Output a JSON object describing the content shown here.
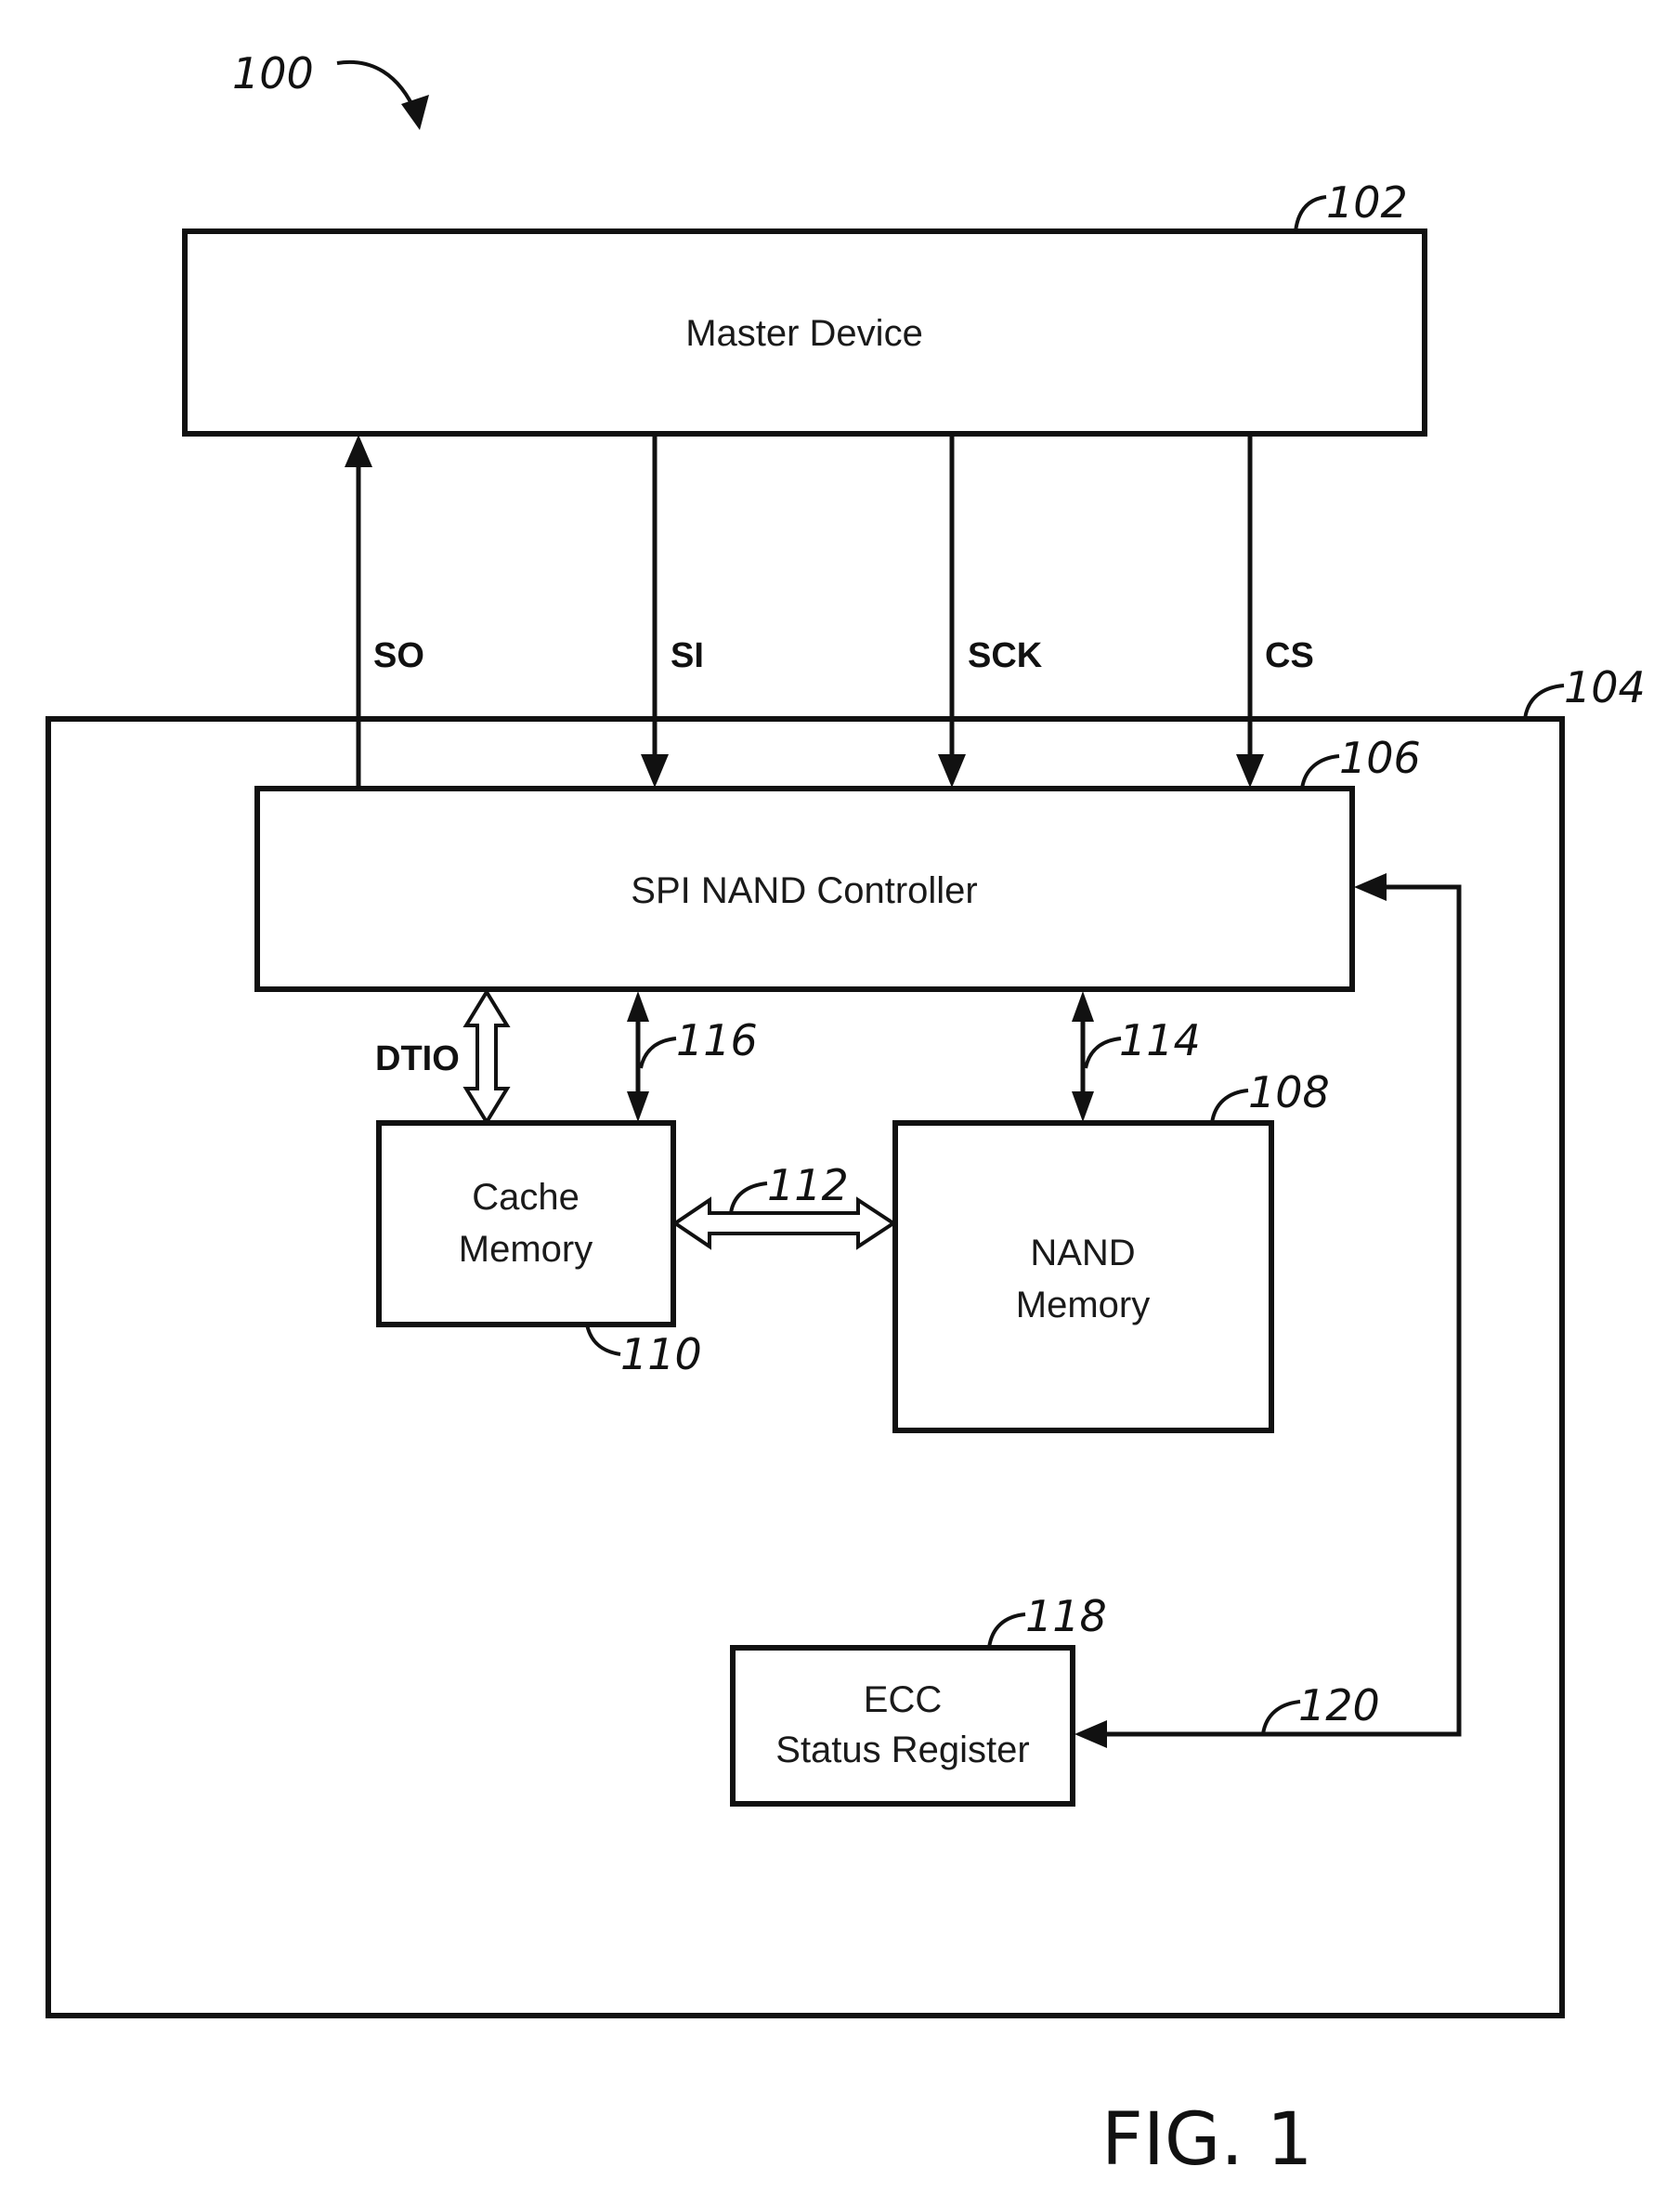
{
  "figure": {
    "ref": "100",
    "caption": "FIG. 1"
  },
  "blocks": {
    "master": {
      "label": "Master Device",
      "ref": "102"
    },
    "memory_device": {
      "ref": "104"
    },
    "controller": {
      "label": "SPI NAND Controller",
      "ref": "106"
    },
    "nand": {
      "label_lines": [
        "NAND",
        "Memory"
      ],
      "ref": "108"
    },
    "cache": {
      "label_lines": [
        "Cache",
        "Memory"
      ],
      "ref": "110"
    },
    "ecc": {
      "label_lines": [
        "ECC",
        "Status Register"
      ],
      "ref": "118"
    }
  },
  "signals": {
    "so": "SO",
    "si": "SI",
    "sck": "SCK",
    "cs": "CS",
    "dtio": "DTIO"
  },
  "connections": {
    "cache_nand": "112",
    "controller_nand": "114",
    "controller_cache": "116",
    "ecc_feedback": "120"
  }
}
